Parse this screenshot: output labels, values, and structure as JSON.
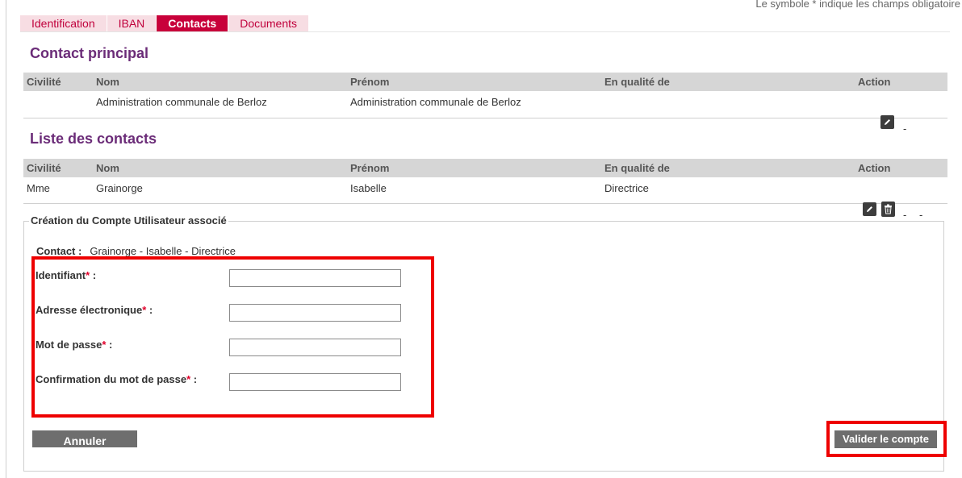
{
  "header": {
    "required_note": "Le symbole * indique les champs obligatoire",
    "tabs": [
      {
        "label": "Identification"
      },
      {
        "label": "IBAN"
      },
      {
        "label": "Contacts"
      },
      {
        "label": "Documents"
      }
    ]
  },
  "main_contact": {
    "title": "Contact principal",
    "columns": [
      "Civilité",
      "Nom",
      "Prénom",
      "En qualité de",
      "Action"
    ],
    "row": {
      "civilite": "",
      "nom": "Administration communale de Berloz",
      "prenom": "Administration communale de Berloz",
      "qualite": "",
      "action_dash": "-"
    }
  },
  "contacts_list": {
    "title": "Liste des contacts",
    "columns": [
      "Civilité",
      "Nom",
      "Prénom",
      "En qualité de",
      "Action"
    ],
    "rows": [
      {
        "civilite": "Mme",
        "nom": "Grainorge",
        "prenom": "Isabelle",
        "qualite": "Directrice",
        "action_dash1": "-",
        "action_dash2": "-"
      }
    ]
  },
  "account_creation": {
    "legend": "Création du Compte Utilisateur associé",
    "contact_label": "Contact :",
    "contact_value": "Grainorge - Isabelle - Directrice",
    "required_mark": "*",
    "colon": ":",
    "fields": [
      {
        "label": "Identifiant",
        "value": ""
      },
      {
        "label": "Adresse électronique",
        "value": ""
      },
      {
        "label": "Mot de passe",
        "value": ""
      },
      {
        "label": "Confirmation du mot de passe",
        "value": ""
      }
    ],
    "cancel_label": "Annuler",
    "validate_label": "Valider le compte"
  },
  "icons": {
    "edit": "edit-icon",
    "delete": "trash-icon"
  },
  "colors": {
    "tab_active": "#c8003a",
    "tab_inactive_bg": "#f7dde3",
    "section_title": "#6b2c78",
    "annotation_red": "#ee0000",
    "button_bg": "#6e6e6e"
  }
}
